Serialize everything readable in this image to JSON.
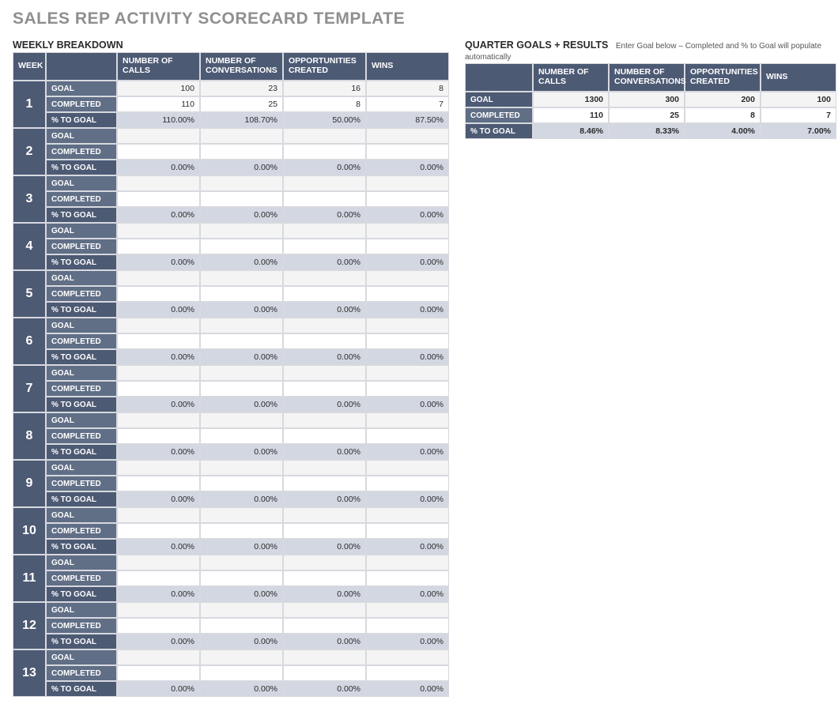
{
  "title": "SALES REP ACTIVITY SCORECARD TEMPLATE",
  "weekly": {
    "heading": "WEEKLY BREAKDOWN",
    "headers": {
      "week": "WEEK",
      "metrics": [
        "NUMBER OF CALLS",
        "NUMBER OF CONVERSATIONS",
        "OPPORTUNITIES CREATED",
        "WINS"
      ]
    },
    "row_labels": {
      "goal": "GOAL",
      "completed": "COMPLETED",
      "pct": "% TO GOAL"
    },
    "weeks": [
      {
        "n": "1",
        "goal": [
          "100",
          "23",
          "16",
          "8"
        ],
        "completed": [
          "110",
          "25",
          "8",
          "7"
        ],
        "pct": [
          "110.00%",
          "108.70%",
          "50.00%",
          "87.50%"
        ]
      },
      {
        "n": "2",
        "goal": [
          "",
          "",
          "",
          ""
        ],
        "completed": [
          "",
          "",
          "",
          ""
        ],
        "pct": [
          "0.00%",
          "0.00%",
          "0.00%",
          "0.00%"
        ]
      },
      {
        "n": "3",
        "goal": [
          "",
          "",
          "",
          ""
        ],
        "completed": [
          "",
          "",
          "",
          ""
        ],
        "pct": [
          "0.00%",
          "0.00%",
          "0.00%",
          "0.00%"
        ]
      },
      {
        "n": "4",
        "goal": [
          "",
          "",
          "",
          ""
        ],
        "completed": [
          "",
          "",
          "",
          ""
        ],
        "pct": [
          "0.00%",
          "0.00%",
          "0.00%",
          "0.00%"
        ]
      },
      {
        "n": "5",
        "goal": [
          "",
          "",
          "",
          ""
        ],
        "completed": [
          "",
          "",
          "",
          ""
        ],
        "pct": [
          "0.00%",
          "0.00%",
          "0.00%",
          "0.00%"
        ]
      },
      {
        "n": "6",
        "goal": [
          "",
          "",
          "",
          ""
        ],
        "completed": [
          "",
          "",
          "",
          ""
        ],
        "pct": [
          "0.00%",
          "0.00%",
          "0.00%",
          "0.00%"
        ]
      },
      {
        "n": "7",
        "goal": [
          "",
          "",
          "",
          ""
        ],
        "completed": [
          "",
          "",
          "",
          ""
        ],
        "pct": [
          "0.00%",
          "0.00%",
          "0.00%",
          "0.00%"
        ]
      },
      {
        "n": "8",
        "goal": [
          "",
          "",
          "",
          ""
        ],
        "completed": [
          "",
          "",
          "",
          ""
        ],
        "pct": [
          "0.00%",
          "0.00%",
          "0.00%",
          "0.00%"
        ]
      },
      {
        "n": "9",
        "goal": [
          "",
          "",
          "",
          ""
        ],
        "completed": [
          "",
          "",
          "",
          ""
        ],
        "pct": [
          "0.00%",
          "0.00%",
          "0.00%",
          "0.00%"
        ]
      },
      {
        "n": "10",
        "goal": [
          "",
          "",
          "",
          ""
        ],
        "completed": [
          "",
          "",
          "",
          ""
        ],
        "pct": [
          "0.00%",
          "0.00%",
          "0.00%",
          "0.00%"
        ]
      },
      {
        "n": "11",
        "goal": [
          "",
          "",
          "",
          ""
        ],
        "completed": [
          "",
          "",
          "",
          ""
        ],
        "pct": [
          "0.00%",
          "0.00%",
          "0.00%",
          "0.00%"
        ]
      },
      {
        "n": "12",
        "goal": [
          "",
          "",
          "",
          ""
        ],
        "completed": [
          "",
          "",
          "",
          ""
        ],
        "pct": [
          "0.00%",
          "0.00%",
          "0.00%",
          "0.00%"
        ]
      },
      {
        "n": "13",
        "goal": [
          "",
          "",
          "",
          ""
        ],
        "completed": [
          "",
          "",
          "",
          ""
        ],
        "pct": [
          "0.00%",
          "0.00%",
          "0.00%",
          "0.00%"
        ]
      }
    ]
  },
  "quarter": {
    "heading": "QUARTER GOALS + RESULTS",
    "hint": "Enter Goal below – Completed and % to Goal will populate automatically",
    "headers": {
      "metrics": [
        "NUMBER OF CALLS",
        "NUMBER OF CONVERSATIONS",
        "OPPORTUNITIES CREATED",
        "WINS"
      ]
    },
    "row_labels": {
      "goal": "GOAL",
      "completed": "COMPLETED",
      "pct": "% TO GOAL"
    },
    "goal": [
      "1300",
      "300",
      "200",
      "100"
    ],
    "completed": [
      "110",
      "25",
      "8",
      "7"
    ],
    "pct": [
      "8.46%",
      "8.33%",
      "4.00%",
      "7.00%"
    ]
  }
}
